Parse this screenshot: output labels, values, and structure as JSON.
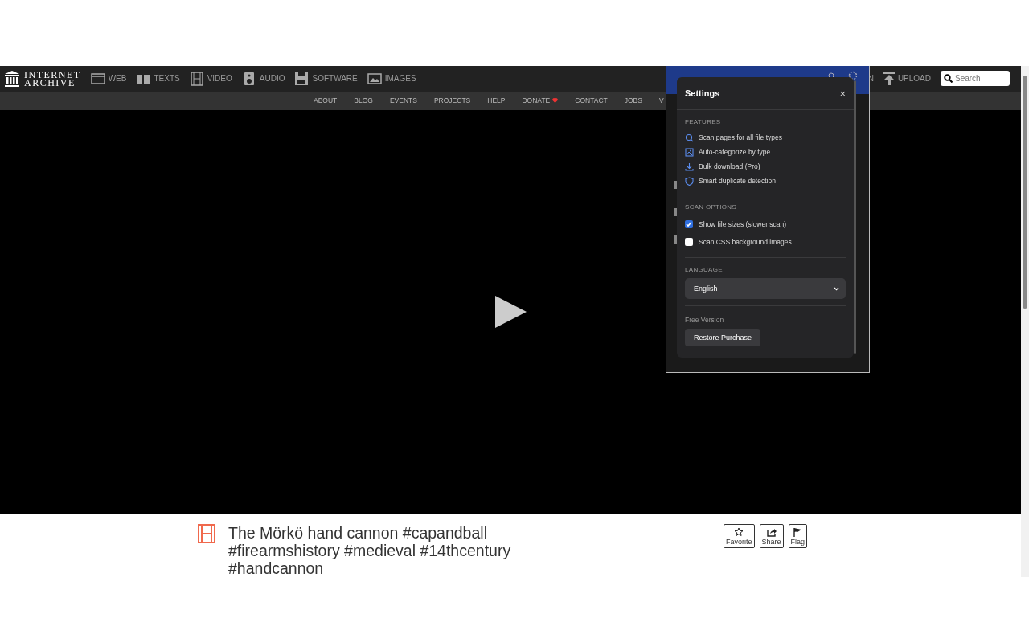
{
  "logo": {
    "line1": "INTERNET",
    "line2": "ARCHIVE"
  },
  "nav": [
    {
      "label": "WEB",
      "kind": "web"
    },
    {
      "label": "TEXTS",
      "kind": "texts"
    },
    {
      "label": "VIDEO",
      "kind": "video"
    },
    {
      "label": "AUDIO",
      "kind": "audio"
    },
    {
      "label": "SOFTWARE",
      "kind": "software"
    },
    {
      "label": "IMAGES",
      "kind": "images"
    }
  ],
  "nav_right": {
    "partial": "N",
    "upload": "UPLOAD",
    "search_placeholder": "Search"
  },
  "subnav": [
    {
      "label": "ABOUT",
      "heart": false
    },
    {
      "label": "BLOG",
      "heart": false
    },
    {
      "label": "EVENTS",
      "heart": false
    },
    {
      "label": "PROJECTS",
      "heart": false
    },
    {
      "label": "HELP",
      "heart": false
    },
    {
      "label": "DONATE",
      "heart": true
    },
    {
      "label": "CONTACT",
      "heart": false
    },
    {
      "label": "JOBS",
      "heart": false
    },
    {
      "label": "V",
      "heart": false
    }
  ],
  "item": {
    "title": "The Mörkö hand cannon #capandball #firearmshistory #medieval #14thcentury #handcannon",
    "actions": [
      {
        "label": "Favorite",
        "kind": "star"
      },
      {
        "label": "Share",
        "kind": "share"
      },
      {
        "label": "Flag",
        "kind": "flag"
      }
    ]
  },
  "settings": {
    "title": "Settings",
    "close": "×",
    "sections": [
      {
        "heading": "FEATURES",
        "kind": "features",
        "items": [
          {
            "label": "Scan pages for all file types",
            "kind": "search"
          },
          {
            "label": "Auto-categorize by type",
            "kind": "image"
          },
          {
            "label": "Bulk download (Pro)",
            "kind": "download"
          },
          {
            "label": "Smart duplicate detection",
            "kind": "shield"
          }
        ]
      },
      {
        "heading": "SCAN OPTIONS",
        "kind": "options",
        "items": [
          {
            "label": "Show file sizes (slower scan)",
            "checked": true
          },
          {
            "label": "Scan CSS background images",
            "checked": false
          }
        ]
      },
      {
        "heading": "LANGUAGE",
        "kind": "language",
        "value": "English"
      }
    ],
    "version": "Free Version",
    "restore": "Restore Purchase"
  }
}
